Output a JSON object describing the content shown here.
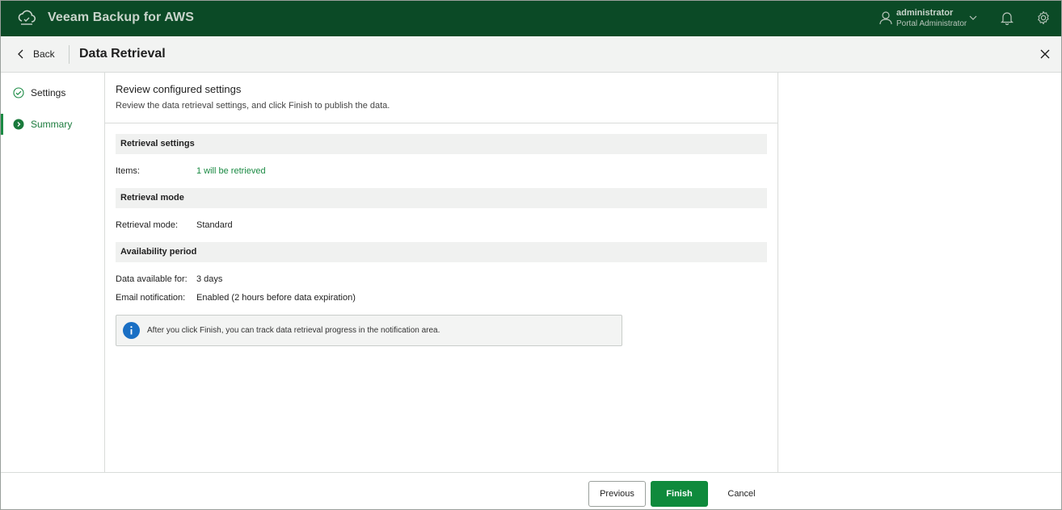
{
  "app": {
    "title": "Veeam Backup for AWS"
  },
  "user": {
    "name": "administrator",
    "role": "Portal Administrator"
  },
  "header": {
    "back_label": "Back",
    "page_title": "Data Retrieval"
  },
  "steps": [
    {
      "label": "Settings",
      "state": "completed"
    },
    {
      "label": "Summary",
      "state": "active"
    }
  ],
  "content": {
    "title": "Review configured settings",
    "description": "Review the data retrieval settings, and click Finish to publish the data."
  },
  "sections": {
    "retrieval_settings": {
      "heading": "Retrieval settings",
      "items_label": "Items:",
      "items_value": "1 will be retrieved"
    },
    "retrieval_mode": {
      "heading": "Retrieval mode",
      "mode_label": "Retrieval mode:",
      "mode_value": "Standard"
    },
    "availability_period": {
      "heading": "Availability period",
      "available_label": "Data available for:",
      "available_value": "3 days",
      "email_label": "Email notification:",
      "email_value": "Enabled (2 hours before data expiration)"
    }
  },
  "info": {
    "text": "After you click Finish, you can track data retrieval progress in the notification area."
  },
  "footer": {
    "previous_label": "Previous",
    "finish_label": "Finish",
    "cancel_label": "Cancel"
  },
  "colors": {
    "topbar": "#0b4a26",
    "accent": "#1a8a43",
    "finish_button": "#0f8a3c",
    "info_icon": "#1a6fc4"
  }
}
